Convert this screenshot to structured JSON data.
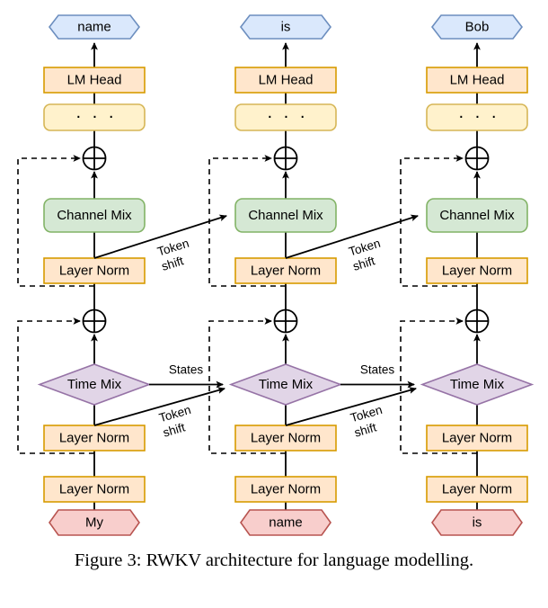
{
  "figure": {
    "caption": "Figure 3: RWKV architecture for language modelling.",
    "title": "RWKV architecture for language modelling"
  },
  "colors": {
    "output_token_fill": "#dae8fc",
    "output_token_stroke": "#6c8ebf",
    "lm_head_fill": "#ffe6cc",
    "lm_head_stroke": "#d79b00",
    "ellipsis_fill": "#fff2cc",
    "ellipsis_stroke": "#d6b656",
    "channel_mix_fill": "#d5e8d4",
    "channel_mix_stroke": "#82b366",
    "layer_norm_fill": "#ffe6cc",
    "layer_norm_stroke": "#d79b00",
    "time_mix_fill": "#e1d5e7",
    "time_mix_stroke": "#9673a6",
    "input_token_fill": "#f8cecc",
    "input_token_stroke": "#b85450",
    "edge": "#000000",
    "background": "#ffffff"
  },
  "columns": [
    {
      "index": 0,
      "input_token": "My",
      "output_token": "name",
      "lm_head": "LM Head",
      "ellipsis": "· · ·",
      "channel_mix": "Channel Mix",
      "time_mix": "Time Mix",
      "layer_norm_channel": "Layer Norm",
      "layer_norm_time": "Layer Norm",
      "layer_norm_embed": "Layer Norm",
      "residual_add_upper": "+",
      "residual_add_lower": "+"
    },
    {
      "index": 1,
      "input_token": "name",
      "output_token": "is",
      "lm_head": "LM Head",
      "ellipsis": "· · ·",
      "channel_mix": "Channel Mix",
      "time_mix": "Time Mix",
      "layer_norm_channel": "Layer Norm",
      "layer_norm_time": "Layer Norm",
      "layer_norm_embed": "Layer Norm",
      "residual_add_upper": "+",
      "residual_add_lower": "+"
    },
    {
      "index": 2,
      "input_token": "is",
      "output_token": "Bob",
      "lm_head": "LM Head",
      "ellipsis": "· · ·",
      "channel_mix": "Channel Mix",
      "time_mix": "Time Mix",
      "layer_norm_channel": "Layer Norm",
      "layer_norm_time": "Layer Norm",
      "layer_norm_embed": "Layer Norm",
      "residual_add_upper": "+",
      "residual_add_lower": "+"
    }
  ],
  "edge_labels": {
    "token_shift_line1": "Token",
    "token_shift_line2": "shift",
    "states": "States"
  },
  "cross_edges": [
    {
      "from_column": 0,
      "to_column": 1,
      "kind": "token-shift-channel",
      "label": "Token shift"
    },
    {
      "from_column": 1,
      "to_column": 2,
      "kind": "token-shift-channel",
      "label": "Token shift"
    },
    {
      "from_column": 0,
      "to_column": 1,
      "kind": "token-shift-time",
      "label": "Token shift"
    },
    {
      "from_column": 1,
      "to_column": 2,
      "kind": "token-shift-time",
      "label": "Token shift"
    },
    {
      "from_column": 0,
      "to_column": 1,
      "kind": "states",
      "label": "States"
    },
    {
      "from_column": 1,
      "to_column": 2,
      "kind": "states",
      "label": "States"
    }
  ]
}
